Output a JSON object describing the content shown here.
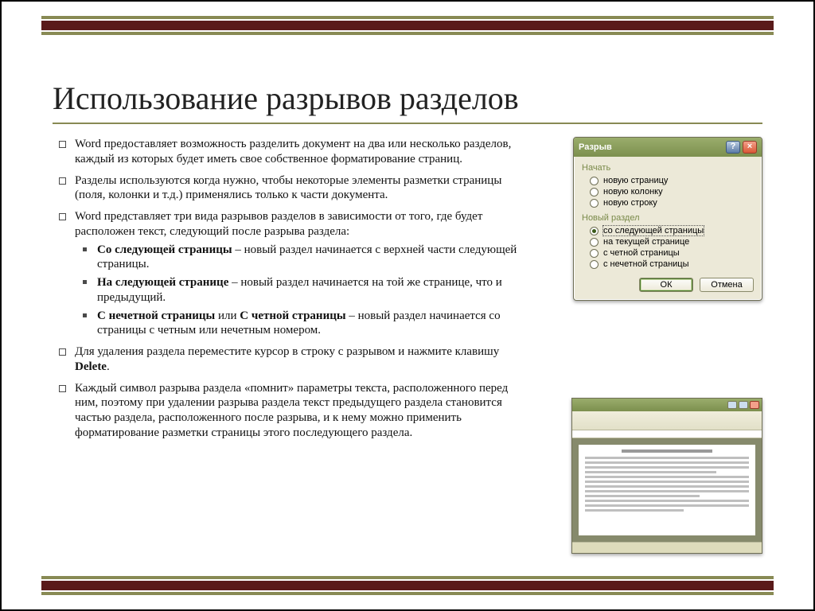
{
  "title": "Использование разрывов разделов",
  "bullets": [
    {
      "text": "Word предоставляет возможность разделить документ на два или несколько разделов, каждый из которых будет иметь свое собственное форматирование страниц."
    },
    {
      "text": "Разделы используются когда нужно, чтобы некоторые элементы разметки страницы (поля, колонки и т.д.) применялись только к части документа."
    },
    {
      "text": "Word представляет три вида разрывов разделов в зависимости от того, где будет расположен текст, следующий после разрыва раздела:",
      "sub": [
        {
          "bold": "Со следующей страницы",
          "rest": " – новый раздел начинается с верхней части следующей страницы."
        },
        {
          "bold": "На следующей странице",
          "rest": " – новый раздел начинается на той же странице, что и предыдущий."
        },
        {
          "bold": "С нечетной страницы",
          "mid": " или ",
          "bold2": "С четной страницы",
          "rest": " – новый раздел начинается со страницы с четным или нечетным номером."
        }
      ]
    },
    {
      "pre": "Для удаления раздела переместите курсор в строку с разрывом и нажмите клавишу ",
      "bold": "Delete",
      "post": "."
    },
    {
      "text": "Каждый символ разрыва раздела «помнит» параметры текста, расположенного перед ним, поэтому при удалении разрыва раздела текст предыдущего раздела становится частью раздела, расположенного после разрыва, и к нему можно применить форматирование разметки страницы этого последующего раздела."
    }
  ],
  "dialog": {
    "title": "Разрыв",
    "group1_label": "Начать",
    "group1": [
      {
        "label": "новую страницу",
        "selected": false
      },
      {
        "label": "новую колонку",
        "selected": false
      },
      {
        "label": "новую строку",
        "selected": false
      }
    ],
    "group2_label": "Новый раздел",
    "group2": [
      {
        "label": "со следующей страницы",
        "selected": true
      },
      {
        "label": "на текущей странице",
        "selected": false
      },
      {
        "label": "с четной страницы",
        "selected": false
      },
      {
        "label": "с нечетной страницы",
        "selected": false
      }
    ],
    "ok": "ОК",
    "cancel": "Отмена"
  }
}
